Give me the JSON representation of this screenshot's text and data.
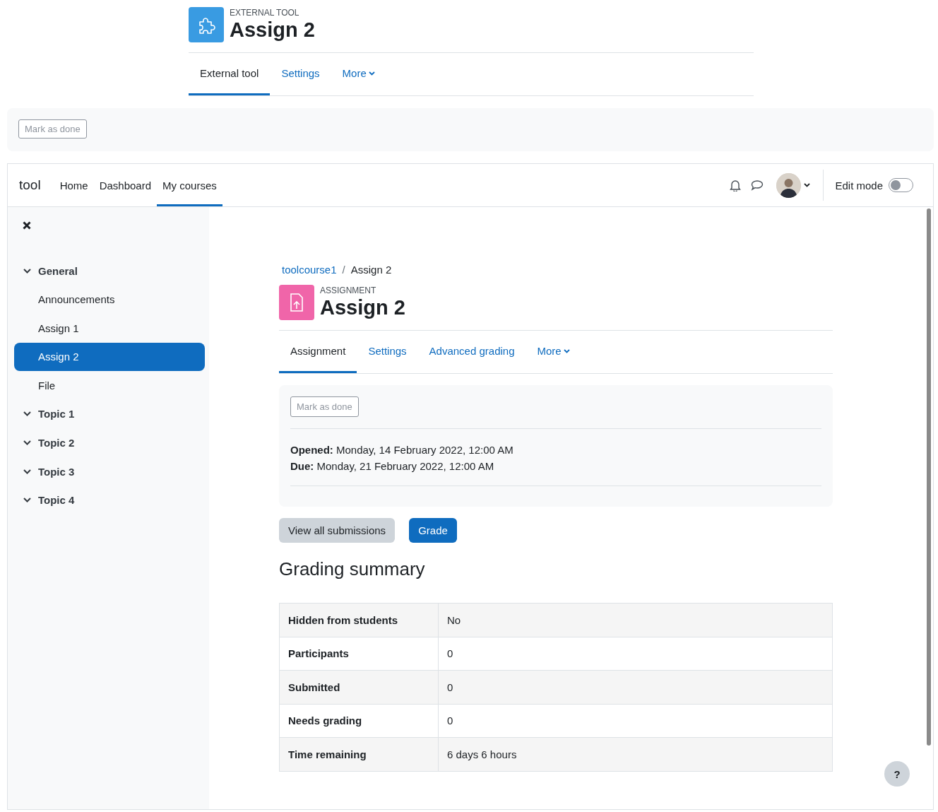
{
  "activity_header": {
    "type_label": "EXTERNAL TOOL",
    "title": "Assign 2",
    "tabs": [
      {
        "label": "External tool",
        "selected": true,
        "kind": "link"
      },
      {
        "label": "Settings",
        "selected": false,
        "kind": "link"
      },
      {
        "label": "More",
        "selected": false,
        "kind": "dropdown"
      }
    ]
  },
  "completion": {
    "button": "Mark as done"
  },
  "navbar": {
    "brand": "tool",
    "links": [
      {
        "label": "Home",
        "selected": false
      },
      {
        "label": "Dashboard",
        "selected": false
      },
      {
        "label": "My courses",
        "selected": true
      }
    ],
    "edit_mode": {
      "label": "Edit mode",
      "on": false
    }
  },
  "course_index": {
    "items": [
      {
        "label": "General",
        "expanded": true,
        "selected": false,
        "children": [
          {
            "label": "Announcements",
            "selected": false
          },
          {
            "label": "Assign 1",
            "selected": false
          },
          {
            "label": "Assign 2",
            "selected": true
          },
          {
            "label": "File",
            "selected": false
          }
        ]
      },
      {
        "label": "Topic 1",
        "expanded": true,
        "selected": false
      },
      {
        "label": "Topic 2",
        "expanded": true,
        "selected": false
      },
      {
        "label": "Topic 3",
        "expanded": true,
        "selected": false
      },
      {
        "label": "Topic 4",
        "expanded": true,
        "selected": false
      }
    ]
  },
  "breadcrumb": [
    {
      "label": "toolcourse1",
      "kind": "link"
    },
    {
      "label": "/",
      "kind": "separator"
    },
    {
      "label": "Assign 2",
      "kind": "current"
    }
  ],
  "activity": {
    "type_label": "ASSIGNMENT",
    "title": "Assign 2",
    "tabs": [
      {
        "label": "Assignment",
        "selected": true,
        "kind": "link"
      },
      {
        "label": "Settings",
        "selected": false,
        "kind": "link"
      },
      {
        "label": "Advanced grading",
        "selected": false,
        "kind": "link"
      },
      {
        "label": "More",
        "selected": false,
        "kind": "dropdown"
      }
    ],
    "completion_button": "Mark as done",
    "dates": [
      "**Opened:** Monday, 14 February 2022, 12:00 AM",
      "**Due:** Monday, 21 February 2022, 12:00 AM"
    ]
  },
  "buttons": [
    {
      "label": "View all submissions",
      "kind": "secondary"
    },
    {
      "label": "Grade",
      "kind": "primary"
    }
  ],
  "grading_summary": {
    "title": "Grading summary",
    "rows": [
      {
        "label": "Hidden from students",
        "value": "No"
      },
      {
        "label": "Participants",
        "value": "0"
      },
      {
        "label": "Submitted",
        "value": "0"
      },
      {
        "label": "Needs grading",
        "value": "0"
      },
      {
        "label": "Time remaining",
        "value": "6 days 6 hours"
      }
    ]
  },
  "help_button": "?"
}
